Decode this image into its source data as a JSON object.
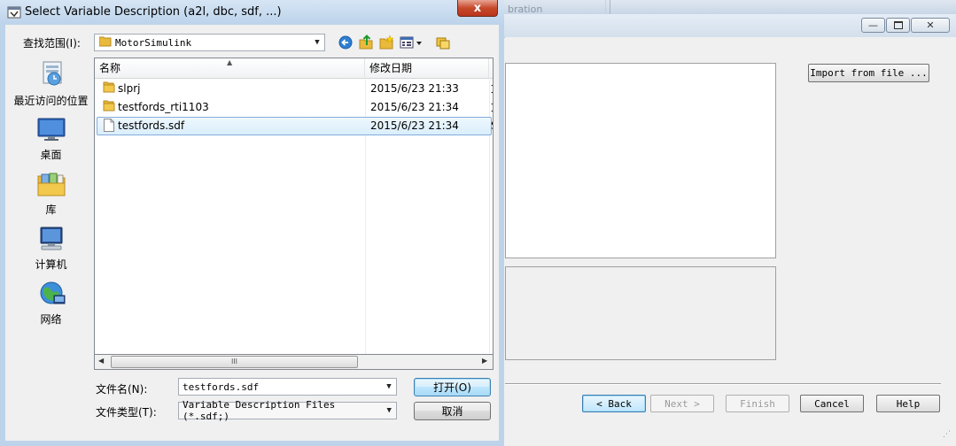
{
  "background_window": {
    "tab_label": "bration",
    "import_button": "Import from file ...",
    "buttons": {
      "back": "< Back",
      "next": "Next >",
      "finish": "Finish",
      "cancel": "Cancel",
      "help": "Help"
    },
    "window_controls": {
      "minimize": "—",
      "maximize": "▫",
      "close": "✕"
    }
  },
  "dialog": {
    "title": "Select Variable Description (a2l, dbc, sdf, ...)",
    "close_glyph": "x",
    "look_in_label": "查找范围(I):",
    "look_in_value": "MotorSimulink",
    "places": [
      {
        "label": "最近访问的位置",
        "icon": "recent-places-icon"
      },
      {
        "label": "桌面",
        "icon": "desktop-icon"
      },
      {
        "label": "库",
        "icon": "libraries-icon"
      },
      {
        "label": "计算机",
        "icon": "computer-icon"
      },
      {
        "label": "网络",
        "icon": "network-icon"
      }
    ],
    "columns": {
      "name": "名称",
      "date": "修改日期",
      "extra": ""
    },
    "files": [
      {
        "name": "slprj",
        "date": "2015/6/23 21:33",
        "extra": "文",
        "type": "folder"
      },
      {
        "name": "testfords_rti1103",
        "date": "2015/6/23 21:34",
        "extra": "文",
        "type": "folder"
      },
      {
        "name": "testfords.sdf",
        "date": "2015/6/23 21:34",
        "extra": "S",
        "type": "file",
        "selected": true
      }
    ],
    "hscroll_grip": "III",
    "filename_label": "文件名(N):",
    "filename_value": "testfords.sdf",
    "filetype_label": "文件类型(T):",
    "filetype_value": "Variable Description Files (*.sdf;)",
    "open_button": "打开(O)",
    "cancel_button": "取消"
  },
  "colors": {
    "title_bar": "#bcd3ea",
    "close_button": "#c7492c",
    "selection": "#d9eefc",
    "folder": "#e8b93a"
  }
}
